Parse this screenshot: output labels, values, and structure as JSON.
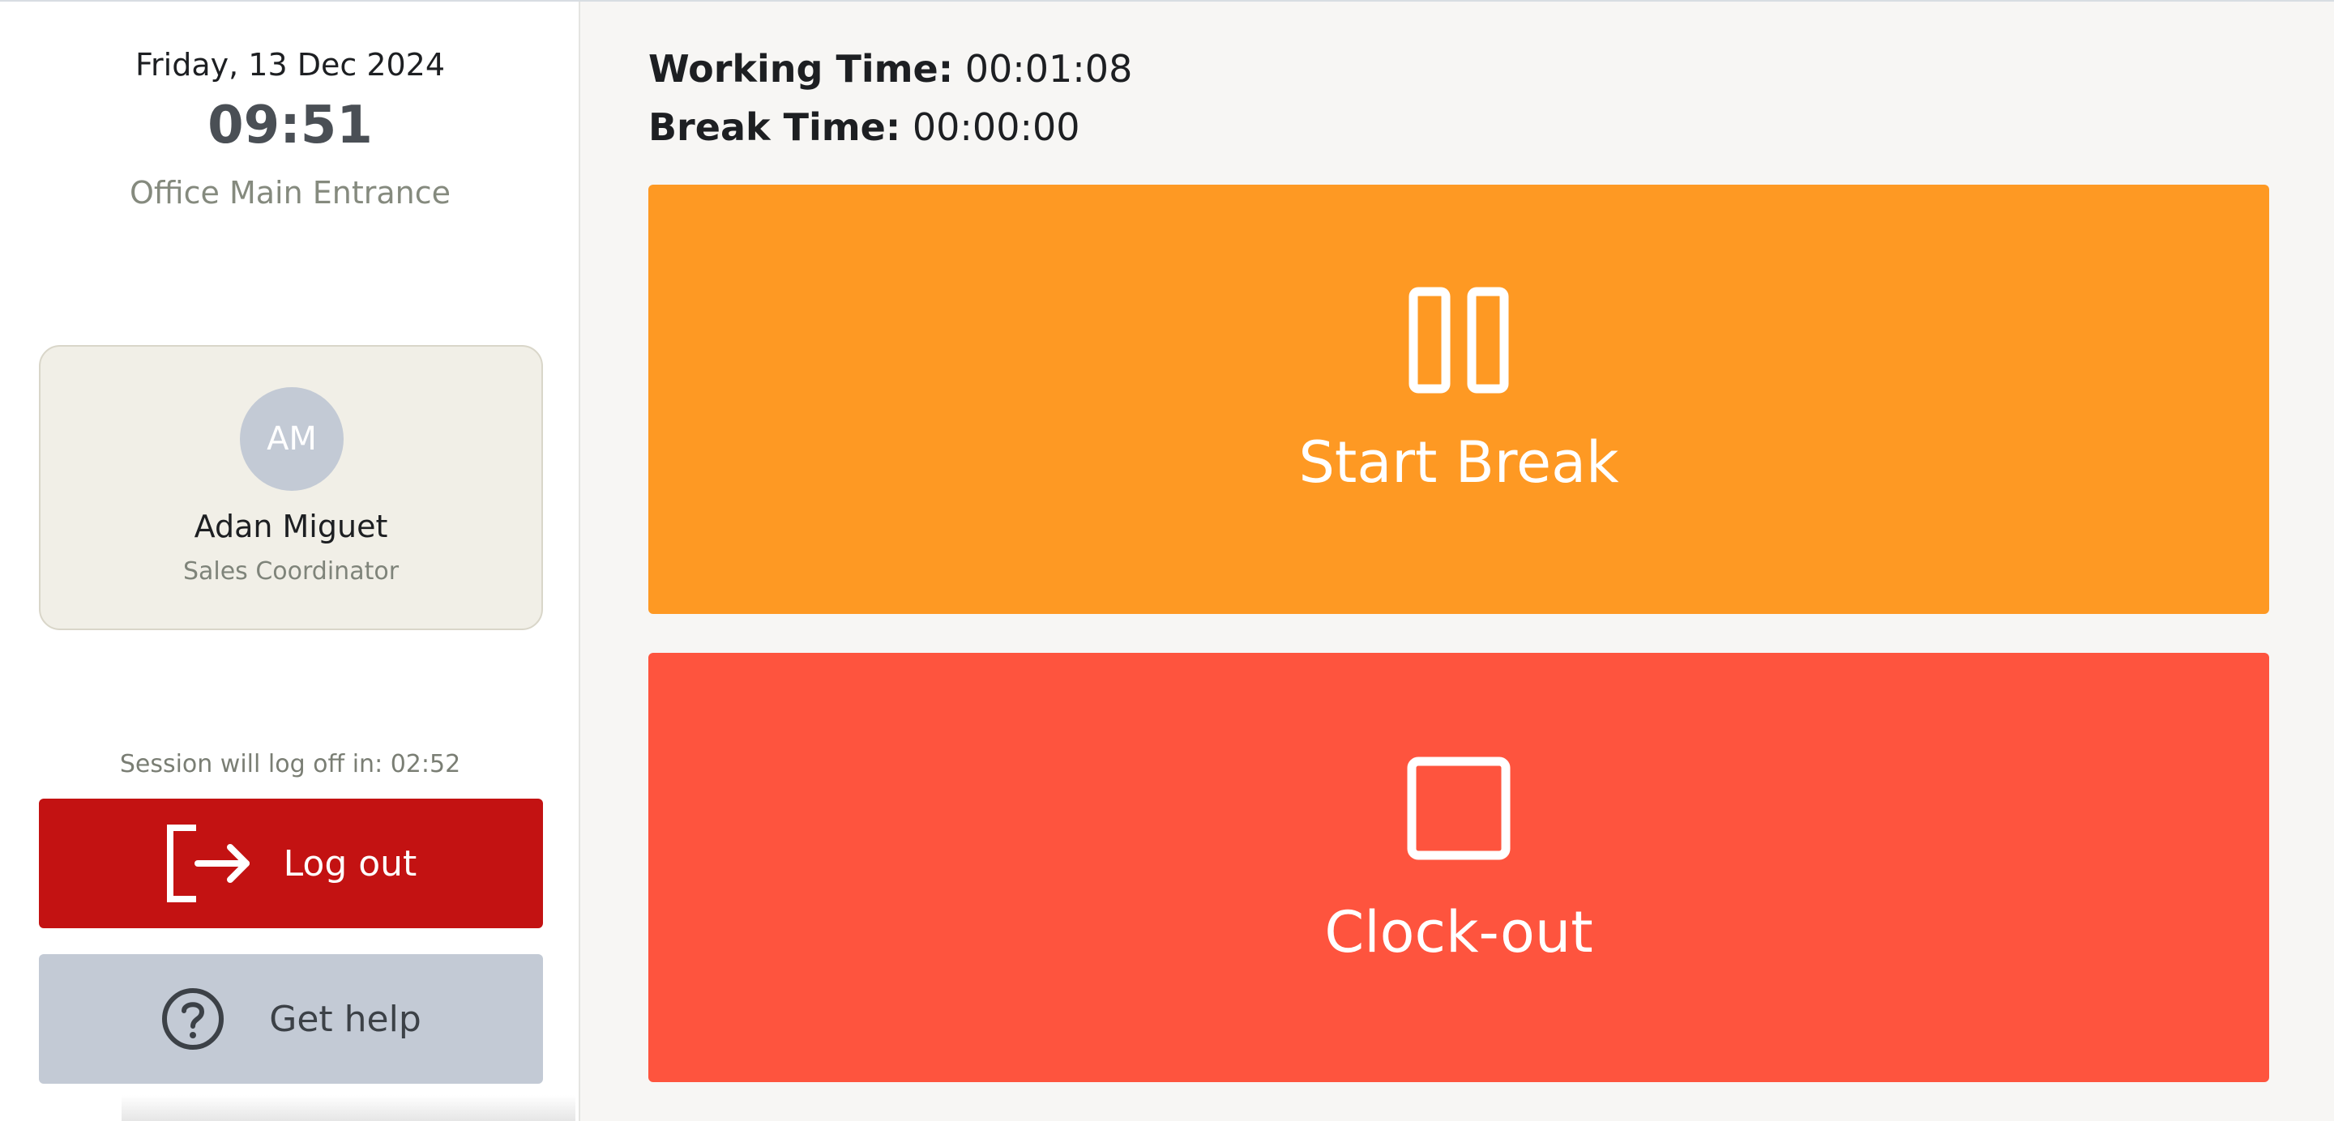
{
  "sidebar": {
    "date": "Friday, 13 Dec 2024",
    "time": "09:51",
    "location": "Office Main Entrance",
    "user": {
      "initials": "AM",
      "name": "Adan Miguet",
      "role": "Sales Coordinator"
    },
    "session_notice": "Session will log off in: 02:52",
    "logout_label": "Log out",
    "help_label": "Get help"
  },
  "main": {
    "working_time_label": "Working Time:",
    "working_time_value": "00:01:08",
    "break_time_label": "Break Time:",
    "break_time_value": "00:00:00",
    "start_break_label": "Start Break",
    "clock_out_label": "Clock-out"
  },
  "icons": {
    "logout": "logout-icon",
    "help": "question-circle-icon",
    "pause": "pause-icon",
    "stop": "stop-icon"
  },
  "colors": {
    "logout_button": "#c31212",
    "help_button": "#c3cad5",
    "start_break_button": "#fe9923",
    "clock_out_button": "#fe543e",
    "avatar": "#c3cad5"
  }
}
